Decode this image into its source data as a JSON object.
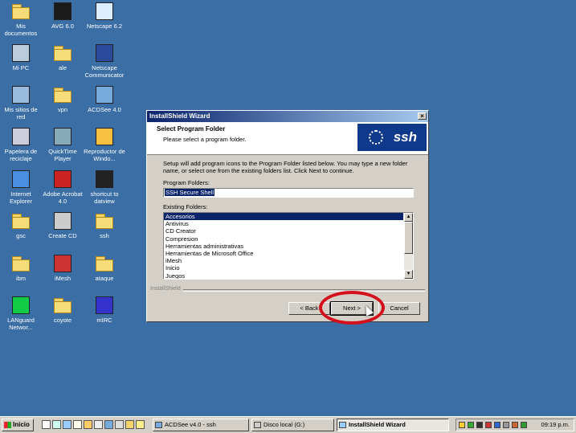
{
  "desktop_icons": [
    {
      "label": "Mis documentos",
      "icon": "folder-documents-icon"
    },
    {
      "label": "AVG 6.0",
      "icon": "avg-icon"
    },
    {
      "label": "Netscape 6.2",
      "icon": "netscape-icon"
    },
    {
      "label": "Mi PC",
      "icon": "computer-icon"
    },
    {
      "label": "ale",
      "icon": "folder-icon"
    },
    {
      "label": "Netscape Communicator",
      "icon": "netscape-communicator-icon"
    },
    {
      "label": "Mis sitios de red",
      "icon": "network-icon"
    },
    {
      "label": "vpn",
      "icon": "folder-icon"
    },
    {
      "label": "ACDSee 4.0",
      "icon": "acdsee-icon"
    },
    {
      "label": "Papelera de reciclaje",
      "icon": "recycle-bin-icon"
    },
    {
      "label": "QuickTime Player",
      "icon": "quicktime-icon"
    },
    {
      "label": "Reproductor de Windo...",
      "icon": "media-player-icon"
    },
    {
      "label": "Internet Explorer",
      "icon": "internet-explorer-icon"
    },
    {
      "label": "Adobe Acrobat 4.0",
      "icon": "acrobat-icon"
    },
    {
      "label": "shortcut to datview",
      "icon": "datview-icon"
    },
    {
      "label": "gsc",
      "icon": "folder-icon"
    },
    {
      "label": "Create CD",
      "icon": "create-cd-icon"
    },
    {
      "label": "ssh",
      "icon": "folder-icon"
    },
    {
      "label": "ibm",
      "icon": "folder-icon"
    },
    {
      "label": "iMesh",
      "icon": "imesh-icon"
    },
    {
      "label": "ataque",
      "icon": "folder-icon"
    },
    {
      "label": "LANguard Networ...",
      "icon": "languard-icon"
    },
    {
      "label": "coyote",
      "icon": "folder-icon"
    },
    {
      "label": "mIRC",
      "icon": "mirc-icon"
    }
  ],
  "dialog": {
    "title": "InstallShield Wizard",
    "close_glyph": "×",
    "header_title": "Select Program Folder",
    "header_subtitle": "Please select a program folder.",
    "logo_text": "ssh",
    "description": "Setup will add program icons to the Program Folder listed below.  You may type a new folder name, or select one from the existing folders list.  Click Next to continue.",
    "program_folders_label": "Program Folders:",
    "program_folder_value": "SSH Secure Shell",
    "existing_folders_label": "Existing Folders:",
    "existing_folders": [
      "Accesorios",
      "Antivirus",
      "CD Creator",
      "Compresion",
      "Herramientas administrativas",
      "Herramientas de Microsoft Office",
      "iMesh",
      "Inicio",
      "Juegos"
    ],
    "brand": "InstallShield",
    "back_label": "< Back",
    "next_label": "Next >",
    "cancel_label": "Cancel"
  },
  "taskbar": {
    "start_label": "Inicio",
    "tasks": [
      {
        "label": "ACDSee v4.0 - ssh",
        "active": false
      },
      {
        "label": "Disco local (G:)",
        "active": false
      },
      {
        "label": "InstallShield Wizard",
        "active": true
      }
    ],
    "clock": "09:19 p.m."
  },
  "colors": {
    "desktop": "#3a6ea5",
    "highlight": "#0a246a",
    "annotation_circle": "#d4101c"
  }
}
